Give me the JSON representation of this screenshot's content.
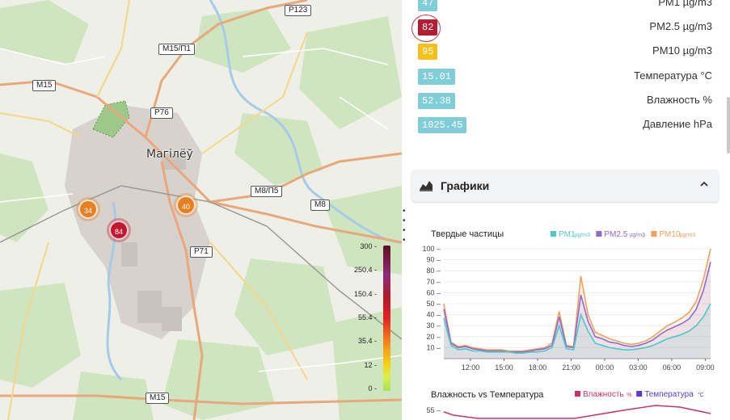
{
  "map": {
    "city_label": "Магілёў",
    "road_signs": [
      {
        "id": "p123",
        "text": "P123"
      },
      {
        "id": "m15p1",
        "text": "M15/П1"
      },
      {
        "id": "m15a",
        "text": "M15"
      },
      {
        "id": "p76",
        "text": "P76"
      },
      {
        "id": "m8p5",
        "text": "M8/П5"
      },
      {
        "id": "m8",
        "text": "M8"
      },
      {
        "id": "p71",
        "text": "P71"
      },
      {
        "id": "m15b",
        "text": "M15"
      }
    ],
    "markers": [
      {
        "id": "m34",
        "value": "34",
        "level": "orange"
      },
      {
        "id": "m40",
        "value": "40",
        "level": "orange"
      },
      {
        "id": "m84",
        "value": "84",
        "level": "red"
      }
    ],
    "legend": {
      "labels": [
        "300 -",
        "250.4 -",
        "150.4 -",
        "55.4 -",
        "35.4 -",
        "12 -",
        "0 -"
      ]
    }
  },
  "metrics": [
    {
      "value": "47",
      "label": "PM1 µg/m3",
      "color": "teal"
    },
    {
      "value": "82",
      "label": "PM2.5 µg/m3",
      "color": "red"
    },
    {
      "value": "95",
      "label": "PM10 µg/m3",
      "color": "yellow"
    },
    {
      "value": "15.01",
      "label": "Температура °C",
      "color": "teal"
    },
    {
      "value": "52.38",
      "label": "Влажность %",
      "color": "teal"
    },
    {
      "value": "1025.45",
      "label": "Давление hPa",
      "color": "teal"
    }
  ],
  "charts_section": {
    "title": "Графики",
    "icon": "area-chart-icon",
    "toggle_icon": "chevron-up-icon"
  },
  "chart_data": [
    {
      "type": "area",
      "title": "Твердые частицы",
      "legend": [
        {
          "name": "PM1",
          "unit": "µg/m3",
          "color": "#4cc9c9"
        },
        {
          "name": "PM2.5",
          "unit": "µg/m3",
          "color": "#8e6bd0"
        },
        {
          "name": "PM10",
          "unit": "µg/m3",
          "color": "#f0a060"
        }
      ],
      "x_ticks": [
        "12:00",
        "15:00",
        "18:00",
        "21:00",
        "00:00",
        "03:00",
        "06:00",
        "09:00"
      ],
      "y_ticks": [
        "100",
        "90",
        "80",
        "70",
        "60",
        "50",
        "40",
        "30",
        "20",
        "10"
      ],
      "ylim": [
        0,
        100
      ],
      "series": [
        {
          "name": "PM1",
          "values": [
            37,
            12,
            8,
            9,
            7,
            7,
            6,
            6,
            6,
            6,
            5,
            5,
            6,
            6,
            7,
            10,
            30,
            9,
            8,
            40,
            25,
            14,
            12,
            10,
            9,
            8,
            8,
            9,
            10,
            12,
            15,
            18,
            20,
            22,
            25,
            30,
            38,
            50
          ]
        },
        {
          "name": "PM2.5",
          "values": [
            45,
            14,
            10,
            11,
            9,
            8,
            7,
            7,
            7,
            6,
            6,
            6,
            7,
            8,
            9,
            12,
            38,
            11,
            10,
            58,
            34,
            20,
            18,
            15,
            14,
            12,
            11,
            12,
            14,
            17,
            22,
            26,
            29,
            32,
            36,
            45,
            62,
            88
          ]
        },
        {
          "name": "PM10",
          "values": [
            50,
            15,
            11,
            12,
            10,
            9,
            8,
            8,
            8,
            7,
            7,
            7,
            8,
            9,
            10,
            14,
            43,
            12,
            11,
            75,
            40,
            24,
            21,
            18,
            16,
            14,
            13,
            14,
            16,
            20,
            25,
            30,
            33,
            37,
            42,
            52,
            72,
            100
          ]
        }
      ]
    },
    {
      "type": "line",
      "title": "Влажность vs Температура",
      "legend": [
        {
          "name": "Влажность",
          "unit": "%",
          "color": "#d0306a"
        },
        {
          "name": "Температура",
          "unit": "°C",
          "color": "#5a3ad0"
        }
      ],
      "y_ticks": [
        "55"
      ]
    }
  ]
}
